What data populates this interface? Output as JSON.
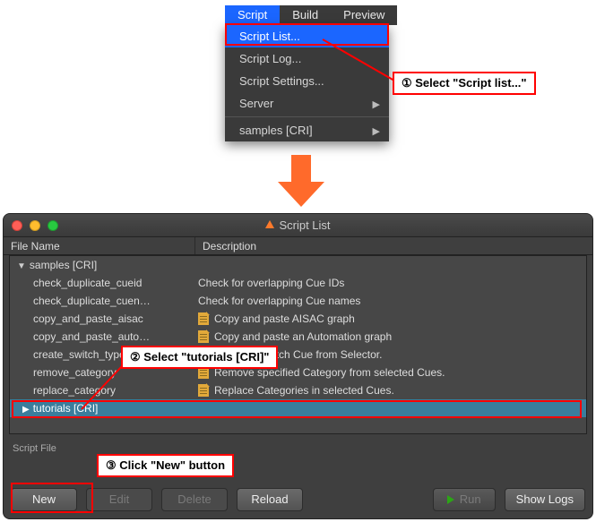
{
  "menubar": {
    "script": "Script",
    "build": "Build",
    "preview": "Preview"
  },
  "dropdown": {
    "script_list": "Script List...",
    "script_log": "Script Log...",
    "script_settings": "Script Settings...",
    "server": "Server",
    "samples": "samples [CRI]"
  },
  "annotations": {
    "step1": "① Select \"Script list...\"",
    "step2": "② Select \"tutorials [CRI]\"",
    "step3": "③ Click \"New\" button"
  },
  "window": {
    "title": "Script List",
    "columns": {
      "file": "File Name",
      "desc": "Description"
    },
    "group": "samples [CRI]",
    "rows": [
      {
        "name": "check_duplicate_cueid",
        "desc": "Check for overlapping Cue IDs",
        "icon": false
      },
      {
        "name": "check_duplicate_cuen…",
        "desc": "Check for overlapping Cue names",
        "icon": false
      },
      {
        "name": "copy_and_paste_aisac",
        "desc": "Copy and paste AISAC graph",
        "icon": true
      },
      {
        "name": "copy_and_paste_auto…",
        "desc": "Copy and paste an Automation graph",
        "icon": true
      },
      {
        "name": "create_switch_type_c…",
        "desc": "Create a Switch Cue from Selector.",
        "icon": true
      },
      {
        "name": "remove_category",
        "desc": "Remove specified Category from selected Cues.",
        "icon": true
      },
      {
        "name": "replace_category",
        "desc": "Replace Categories in selected Cues.",
        "icon": true
      }
    ],
    "selected": "tutorials [CRI]",
    "script_file_label": "Script File",
    "buttons": {
      "new": "New",
      "edit": "Edit",
      "delete": "Delete",
      "reload": "Reload",
      "run": "Run",
      "show_logs": "Show Logs"
    }
  }
}
